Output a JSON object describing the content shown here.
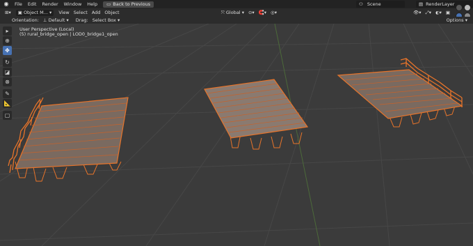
{
  "topbar": {
    "menus": [
      "File",
      "Edit",
      "Render",
      "Window",
      "Help"
    ],
    "back_label": "Back to Previous",
    "scene_label": "Scene",
    "render_layer_label": "RenderLayer"
  },
  "header": {
    "mode_label": "Object M...",
    "menus": [
      "View",
      "Select",
      "Add",
      "Object"
    ],
    "transform_label": "Global"
  },
  "tool_settings": {
    "orientation_label": "Orientation:",
    "orientation_value": "Default",
    "drag_label": "Drag:",
    "drag_value": "Select Box",
    "options_label": "Options"
  },
  "viewport": {
    "perspective_label": "User Perspective (Local)",
    "object_label": "(5) rural_bridge_open | LOD0_bridge1_open"
  },
  "tools": [
    "select-box-icon",
    "cursor-icon",
    "move-icon",
    "rotate-icon",
    "scale-icon",
    "transform-icon",
    "annotate-icon",
    "measure-icon",
    "add-cube-icon"
  ],
  "colors": {
    "outline": "#e8742a",
    "wood": "#7a6a60",
    "viewport_bg": "#3b3b3b",
    "grid": "#474747",
    "active_tool": "#4772b3"
  }
}
